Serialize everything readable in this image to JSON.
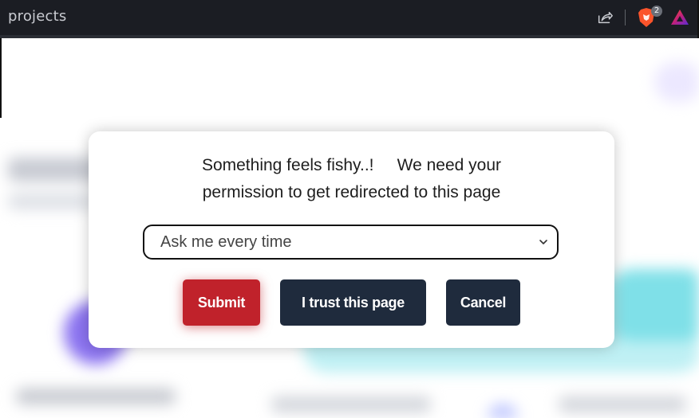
{
  "browser": {
    "tab_title": "projects",
    "brave_shields_count": "2"
  },
  "modal": {
    "message_line1": "Something feels fishy..!     We need your",
    "message_line2": "permission to get redirected to this page",
    "select": {
      "selected_value": "Ask me every time"
    },
    "buttons": {
      "submit_label": "Submit",
      "trust_label": "I trust this page",
      "cancel_label": "Cancel"
    }
  },
  "colors": {
    "topbar": "#1b1d23",
    "submit": "#c0222b",
    "dark_button": "#1f2b3d",
    "brave_orange": "#fb542b"
  }
}
